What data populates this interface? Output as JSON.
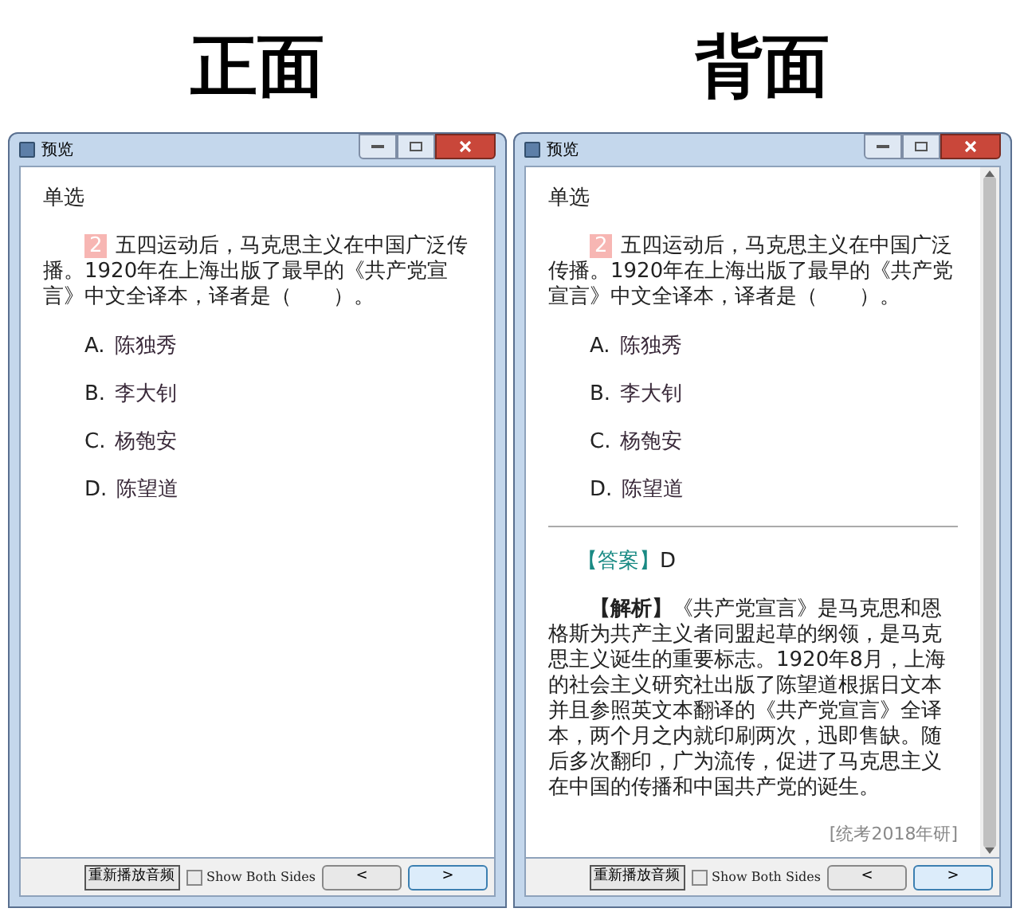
{
  "panels": [
    {
      "heading": "正面",
      "window": {
        "title": "预览",
        "scrollbar": false,
        "question_type": "单选",
        "number": "2",
        "stem": "五四运动后，马克思主义在中国广泛传播。1920年在上海出版了最早的《共产党宣言》中文全译本，译者是（　　）。",
        "options": [
          {
            "letter": "A.",
            "text": "陈独秀"
          },
          {
            "letter": "B.",
            "text": "李大钊"
          },
          {
            "letter": "C.",
            "text": "杨匏安"
          },
          {
            "letter": "D.",
            "text": "陈望道"
          }
        ],
        "replay_button": "重新播放音频",
        "show_both_sides": {
          "label": "Show Both Sides",
          "checked": false
        },
        "prev_button": "<",
        "next_button": ">"
      }
    },
    {
      "heading": "背面",
      "window": {
        "title": "预览",
        "scrollbar": true,
        "question_type": "单选",
        "number": "2",
        "stem": "五四运动后，马克思主义在中国广泛传播。1920年在上海出版了最早的《共产党宣言》中文全译本，译者是（　　）。",
        "options": [
          {
            "letter": "A.",
            "text": "陈独秀"
          },
          {
            "letter": "B.",
            "text": "李大钊"
          },
          {
            "letter": "C.",
            "text": "杨匏安"
          },
          {
            "letter": "D.",
            "text": "陈望道"
          }
        ],
        "answer": {
          "label": "【答案】",
          "value": "D"
        },
        "analysis": "**【解析】**《共产党宣言》是马克思和恩格斯为共产主义者同盟起草的纲领，是马克思主义诞生的重要标志。1920年8月，上海的社会主义研究社出版了陈望道根据日文本并且参照英文本翻译的《共产党宣言》全译本，两个月之内就印刷两次，迅即售缺。随后多次翻印，广为流传，促进了马克思主义在中国的传播和中国共产党的诞生。",
        "source": "[统考2018年研]",
        "replay_button": "重新播放音频",
        "show_both_sides": {
          "label": "Show Both Sides",
          "checked": false
        },
        "prev_button": "<",
        "next_button": ">"
      }
    }
  ]
}
